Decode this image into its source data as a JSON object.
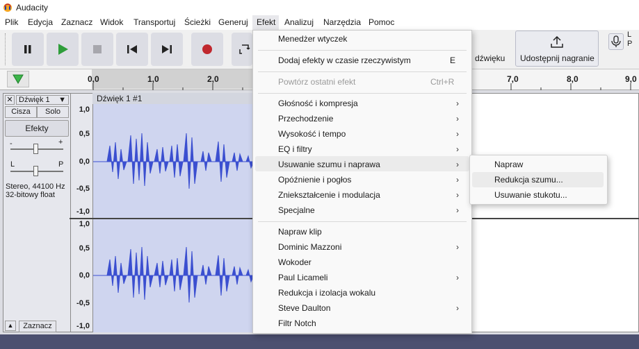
{
  "window": {
    "title": "Audacity"
  },
  "menubar": [
    "Plik",
    "Edycja",
    "Zaznacz",
    "Widok",
    "Transportuj",
    "Ścieżki",
    "Generuj",
    "Efekt",
    "Analizuj",
    "Narzędzia",
    "Pomoc"
  ],
  "toolbar": {
    "share_label": "Udostępnij nagranie",
    "partial_label": "dźwięku",
    "meter_letters": [
      "L",
      "P"
    ]
  },
  "ruler": {
    "ticks": [
      "0,0",
      "1,0",
      "2,0",
      "7,0",
      "8,0",
      "9,0"
    ]
  },
  "track": {
    "name": "Dźwięk 1",
    "mute_label": "Cisza",
    "solo_label": "Solo",
    "effects_label": "Efekty",
    "pan_left": "L",
    "pan_right": "P",
    "gain_minus": "-",
    "gain_plus": "+",
    "info_line1": "Stereo, 44100 Hz",
    "info_line2": "32-bitowy float",
    "select_label": "Zaznacz",
    "clip_title": "Dźwięk 1 #1",
    "scale": [
      "1,0",
      "0,5",
      "0,0",
      "-0,5",
      "-1,0",
      "1,0",
      "0,5",
      "0,0",
      "-0,5",
      "-1,0"
    ]
  },
  "efekt_menu": {
    "items": [
      {
        "label": "Menedżer wtyczek"
      },
      {
        "label": "Dodaj efekty w czasie rzeczywistym",
        "shortcut": "E"
      },
      {
        "label": "Powtórz ostatni efekt",
        "shortcut": "Ctrl+R",
        "disabled": true
      },
      {
        "label": "Głośność i kompresja",
        "submenu": true
      },
      {
        "label": "Przechodzenie",
        "submenu": true
      },
      {
        "label": "Wysokość i tempo",
        "submenu": true
      },
      {
        "label": "EQ i filtry",
        "submenu": true
      },
      {
        "label": "Usuwanie szumu i naprawa",
        "submenu": true,
        "highlighted": true
      },
      {
        "label": "Opóźnienie i pogłos",
        "submenu": true
      },
      {
        "label": "Zniekształcenie i modulacja",
        "submenu": true
      },
      {
        "label": "Specjalne",
        "submenu": true
      },
      {
        "label": "Napraw klip"
      },
      {
        "label": "Dominic Mazzoni",
        "submenu": true
      },
      {
        "label": "Wokoder"
      },
      {
        "label": "Paul Licameli",
        "submenu": true
      },
      {
        "label": "Redukcja i izolacja wokalu"
      },
      {
        "label": "Steve Daulton",
        "submenu": true
      },
      {
        "label": "Filtr Notch"
      }
    ]
  },
  "submenu": {
    "items": [
      {
        "label": "Napraw"
      },
      {
        "label": "Redukcja szumu...",
        "highlighted": true
      },
      {
        "label": "Usuwanie stukotu..."
      }
    ]
  },
  "colors": {
    "waveform": "#3b4fd0",
    "accent_green": "#2e9d3a",
    "record_red": "#c0282e"
  }
}
